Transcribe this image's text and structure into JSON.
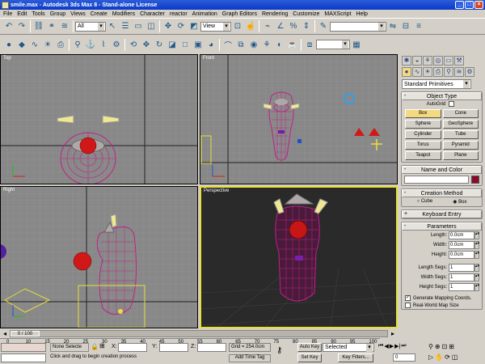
{
  "window": {
    "title": "smile.max - Autodesk 3ds Max 8 - Stand-alone License"
  },
  "menu": [
    "File",
    "Edit",
    "Tools",
    "Group",
    "Views",
    "Create",
    "Modifiers",
    "Character",
    "reactor",
    "Animation",
    "Graph Editors",
    "Rendering",
    "Customize",
    "MAXScript",
    "Help"
  ],
  "toolbar": {
    "selection_filter": "All",
    "ref_coord": "View",
    "named_sel": ""
  },
  "viewports": {
    "top": "Top",
    "front": "Front",
    "left": "Right",
    "perspective": "Perspective"
  },
  "command_panel": {
    "category": "Standard Primitives",
    "object_type_title": "Object Type",
    "autogrid_label": "AutoGrid",
    "primitives": [
      "Box",
      "Cone",
      "Sphere",
      "GeoSphere",
      "Cylinder",
      "Tube",
      "Torus",
      "Pyramid",
      "Teapot",
      "Plane"
    ],
    "active_primitive": "Box",
    "name_color_title": "Name and Color",
    "object_color": "#8b0a2a",
    "creation_method_title": "Creation Method",
    "creation_methods": [
      "Cube",
      "Box"
    ],
    "keyboard_entry_title": "Keyboard Entry",
    "parameters_title": "Parameters",
    "length_label": "Length:",
    "length_value": "0.0cm",
    "width_label": "Width:",
    "width_value": "0.0cm",
    "height_label": "Height:",
    "height_value": "0.0cm",
    "length_segs_label": "Length Segs:",
    "length_segs_value": "1",
    "width_segs_label": "Width Segs:",
    "width_segs_value": "1",
    "height_segs_label": "Height Segs:",
    "height_segs_value": "1",
    "gen_mapping_label": "Generate Mapping Coords.",
    "real_world_label": "Real-World Map Size"
  },
  "time": {
    "slider_label": "0 / 100",
    "ticks": [
      "0",
      "10",
      "15",
      "20",
      "25",
      "30",
      "35",
      "40",
      "45",
      "50",
      "55",
      "60",
      "65",
      "70",
      "75",
      "80",
      "85",
      "90",
      "95",
      "100"
    ]
  },
  "status": {
    "selection": "None Selecte",
    "prompt": "Click and drag to begin creation process",
    "x_label": "X:",
    "y_label": "Y:",
    "z_label": "Z:",
    "grid": "Grid = 254.0cm",
    "add_time_tag": "Add Time Tag",
    "auto_key": "Auto Key",
    "set_key": "Set Key",
    "key_mode": "Selected",
    "key_filters": "Key Filters...",
    "frame": "0"
  },
  "colors": {
    "accent_yellow": "#e8de3a",
    "mesh_magenta": "#c0208a",
    "sphere_red": "#d01818"
  }
}
